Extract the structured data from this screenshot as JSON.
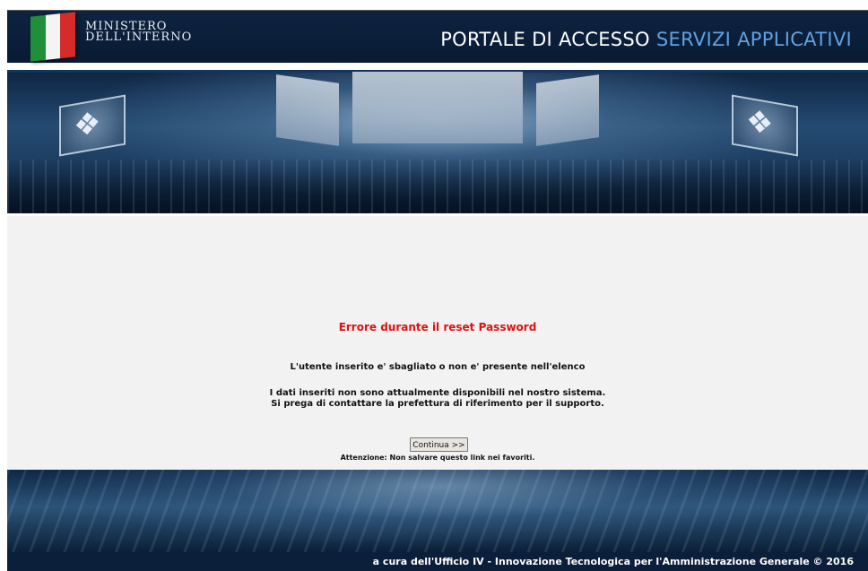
{
  "header": {
    "ministry_line1": "MINISTERO",
    "ministry_line2": "DELL'INTERNO",
    "portal_title_white": "PORTALE DI ACCESSO",
    "portal_title_blue": "SERVIZI APPLICATIVI",
    "flag_colors": [
      "#1f8f3a",
      "#f4f4f4",
      "#d62b2b"
    ]
  },
  "content": {
    "error_title": "Errore durante il reset Password",
    "message_user": "L'utente inserito e' sbagliato o non e' presente nell'elenco",
    "message_data_line1": "I dati inseriti non sono attualmente disponibili nel nostro sistema.",
    "message_data_line2": "Si prega di contattare la prefettura di riferimento per il supporto.",
    "continue_button": "Continua >>",
    "warning": "Attenzione: Non salvare questo link nei favoriti."
  },
  "footer": {
    "text": "a cura dell'Ufficio IV - Innovazione Tecnologica per l'Amministrazione Generale  © 2016"
  },
  "colors": {
    "header_bg": "#0d2341",
    "error_red": "#e01010",
    "accent_blue": "#5fa2e0",
    "content_bg": "#f2f2f2"
  }
}
